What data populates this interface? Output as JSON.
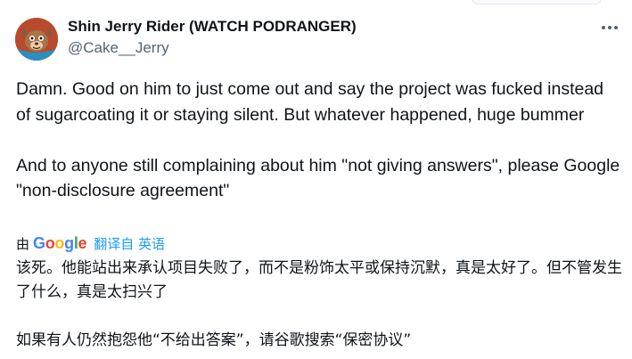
{
  "author": {
    "display_name": "Shin Jerry Rider (WATCH PODRANGER)",
    "handle": "@Cake__Jerry",
    "avatar_icon": "cartoon-character-avatar"
  },
  "menu": {
    "more_icon": "more-horizontal-icon"
  },
  "tweet": {
    "text": "Damn. Good on him to just come out and say the project was fucked instead of sugarcoating it or staying silent. But whatever happened, huge bummer\n\nAnd to anyone still complaining about him \"not giving answers\", please Google \"non-disclosure agreement\""
  },
  "translation": {
    "by_label": "由",
    "provider": "Google",
    "provider_letters": [
      "G",
      "o",
      "o",
      "g",
      "l",
      "e"
    ],
    "provider_colors": [
      "#4285F4",
      "#EA4335",
      "#FBBC05",
      "#4285F4",
      "#34A853",
      "#EA4335"
    ],
    "link_label": "翻译自 英语",
    "text": "该死。他能站出来承认项目失败了，而不是粉饰太平或保持沉默，真是太好了。但不管发生了什么，真是太扫兴了\n\n如果有人仍然抱怨他“不给出答案”，请谷歌搜索“保密协议”"
  },
  "colors": {
    "text_primary": "#0f1419",
    "text_secondary": "#536471",
    "link": "#1d9bf0"
  }
}
